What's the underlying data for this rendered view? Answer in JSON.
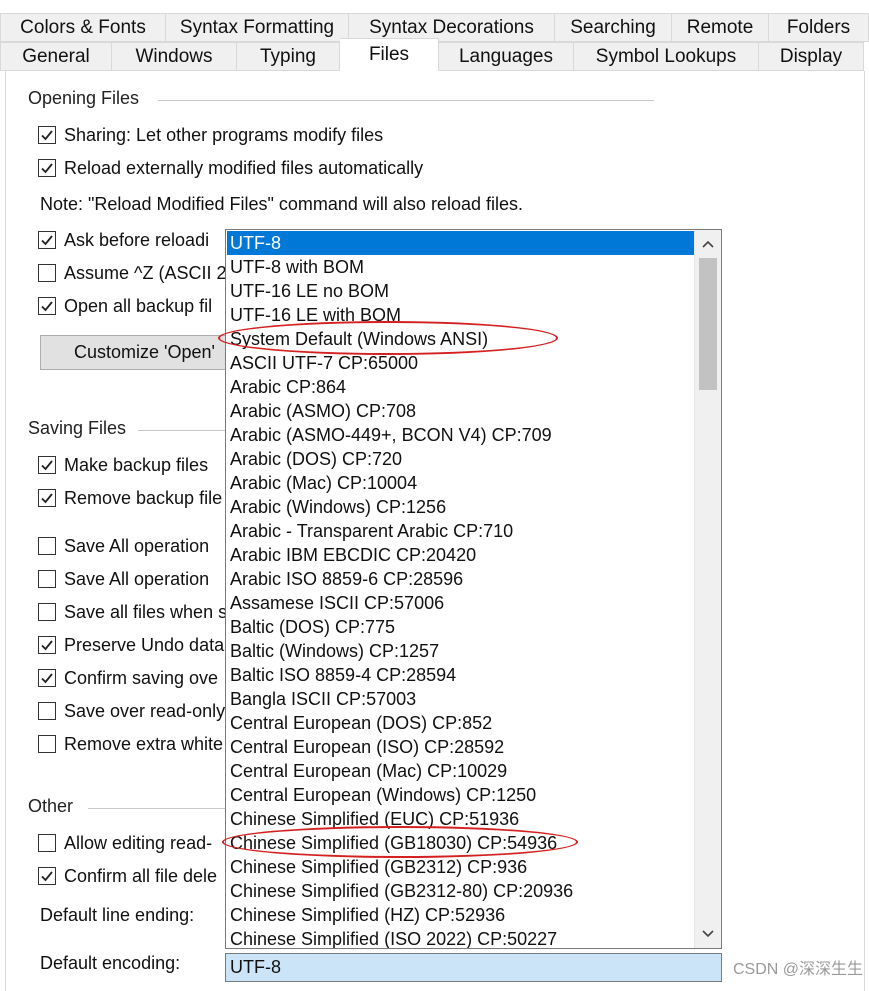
{
  "tabs": {
    "top": [
      "Colors & Fonts",
      "Syntax Formatting",
      "Syntax Decorations",
      "Searching",
      "Remote",
      "Folders"
    ],
    "bottom": [
      "General",
      "Windows",
      "Typing",
      "Files",
      "Languages",
      "Symbol Lookups",
      "Display"
    ],
    "active": "Files"
  },
  "opening": {
    "title": "Opening Files",
    "sharing": "Sharing: Let other programs modify files",
    "reload": "Reload externally modified files automatically",
    "note": "Note: \"Reload Modified Files\" command will also reload files.",
    "ask": "Ask before reloadi",
    "assume": "Assume ^Z (ASCII 2",
    "open_backup": "Open all backup fil",
    "customize_button": "Customize 'Open'"
  },
  "saving": {
    "title": "Saving Files",
    "make_backup": "Make backup files",
    "remove_backup": "Remove backup file",
    "save_all_1": "Save All operation",
    "save_all_2": "Save All operation",
    "save_all_files": "Save all files when s",
    "preserve_undo": "Preserve Undo data",
    "confirm_saving": "Confirm saving ove",
    "save_readonly": "Save over read-only",
    "remove_extra": "Remove extra white"
  },
  "other": {
    "title": "Other",
    "allow_editing": "Allow editing read-",
    "confirm_delete": "Confirm all file dele",
    "line_ending_label": "Default line ending:",
    "encoding_label": "Default encoding:"
  },
  "encoding": {
    "selected": "UTF-8",
    "options": [
      "UTF-8",
      "UTF-8 with BOM",
      "UTF-16 LE no BOM",
      "UTF-16 LE with BOM",
      "System Default (Windows ANSI)",
      "ASCII UTF-7  CP:65000",
      "Arabic  CP:864",
      "Arabic (ASMO)  CP:708",
      "Arabic (ASMO-449+, BCON V4)  CP:709",
      "Arabic (DOS)  CP:720",
      "Arabic (Mac)  CP:10004",
      "Arabic (Windows)  CP:1256",
      "Arabic - Transparent Arabic  CP:710",
      "Arabic IBM EBCDIC  CP:20420",
      "Arabic ISO 8859-6   CP:28596",
      "Assamese ISCII  CP:57006",
      "Baltic (DOS)  CP:775",
      "Baltic (Windows)  CP:1257",
      "Baltic ISO 8859-4   CP:28594",
      "Bangla ISCII  CP:57003",
      "Central European (DOS)  CP:852",
      "Central European (ISO)  CP:28592",
      "Central European (Mac)  CP:10029",
      "Central European (Windows)  CP:1250",
      "Chinese Simplified (EUC)  CP:51936",
      "Chinese Simplified (GB18030)  CP:54936",
      "Chinese Simplified (GB2312)  CP:936",
      "Chinese Simplified (GB2312-80)  CP:20936",
      "Chinese Simplified (HZ)  CP:52936",
      "Chinese Simplified (ISO 2022)  CP:50227"
    ]
  },
  "watermark": "CSDN @深深生生",
  "colors": {
    "accent": "#0078d7",
    "highlight_ring": "#d42020",
    "combo_bg": "#cce4f7"
  }
}
